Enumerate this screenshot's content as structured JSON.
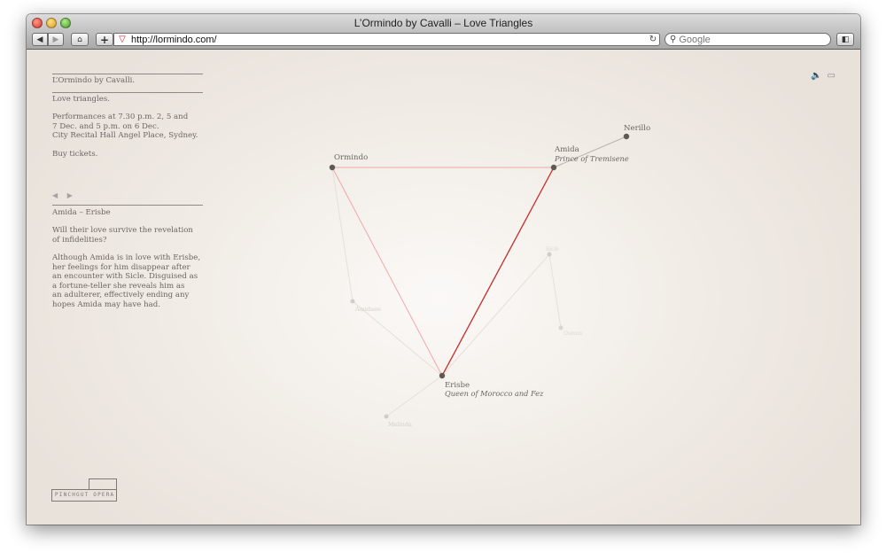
{
  "browser": {
    "title": "L’Ormindo by Cavalli – Love Triangles",
    "url": "http://lormindo.com/",
    "search_placeholder": "Google",
    "back": "◀",
    "forward": "▶",
    "home": "⌂",
    "add": "+",
    "reload": "↻",
    "search_icon": "⚲",
    "favicon": "▽",
    "bookmark": "◧"
  },
  "sidebar": {
    "title": "L’Ormindo by Cavalli.",
    "subtitle": "Love triangles.",
    "performances": [
      "Performances at 7.30 p.m. 2, 5 and",
      "7 Dec. and 5 p.m. on 6 Dec.",
      "City Recital Hall Angel Place, Sydney."
    ],
    "buy": "Buy tickets.",
    "pager": "◀ ▶",
    "pair": "Amida – Erisbe",
    "question": [
      "Will their love survive the revelation",
      "of infidelities?"
    ],
    "description": [
      "Although Amida is in love with Erisbe,",
      "her feelings for him disappear after",
      "an encounter with Sicle. Disguised as",
      "a fortune-teller she reveals him as",
      "an adulterer, effectively ending any",
      "hopes Amida may have had."
    ]
  },
  "logo": {
    "text": "PINCHGUT OPERA"
  },
  "tools": {
    "sound_icon": "🔈",
    "screen_icon": "▭"
  },
  "graph": {
    "nodes": [
      {
        "id": "ormindo",
        "name": "Ormindo",
        "subtitle": ""
      },
      {
        "id": "amida",
        "name": "Amida",
        "subtitle": "Prince of Tremisene"
      },
      {
        "id": "nerillo",
        "name": "Nerillo",
        "subtitle": ""
      },
      {
        "id": "erisbe",
        "name": "Erisbe",
        "subtitle": "Queen of Morocco and Fez"
      },
      {
        "id": "faded1",
        "name": "Amidaeo",
        "subtitle": ""
      },
      {
        "id": "faded2",
        "name": "Melinda",
        "subtitle": ""
      },
      {
        "id": "faded3",
        "name": "Sicle",
        "subtitle": ""
      },
      {
        "id": "faded4",
        "name": "Osman",
        "subtitle": ""
      }
    ],
    "colors": {
      "highlight": "#c62b2b",
      "soft": "#f0a8a8",
      "node": "#5f5956",
      "faded": "#c9c1bc"
    }
  }
}
